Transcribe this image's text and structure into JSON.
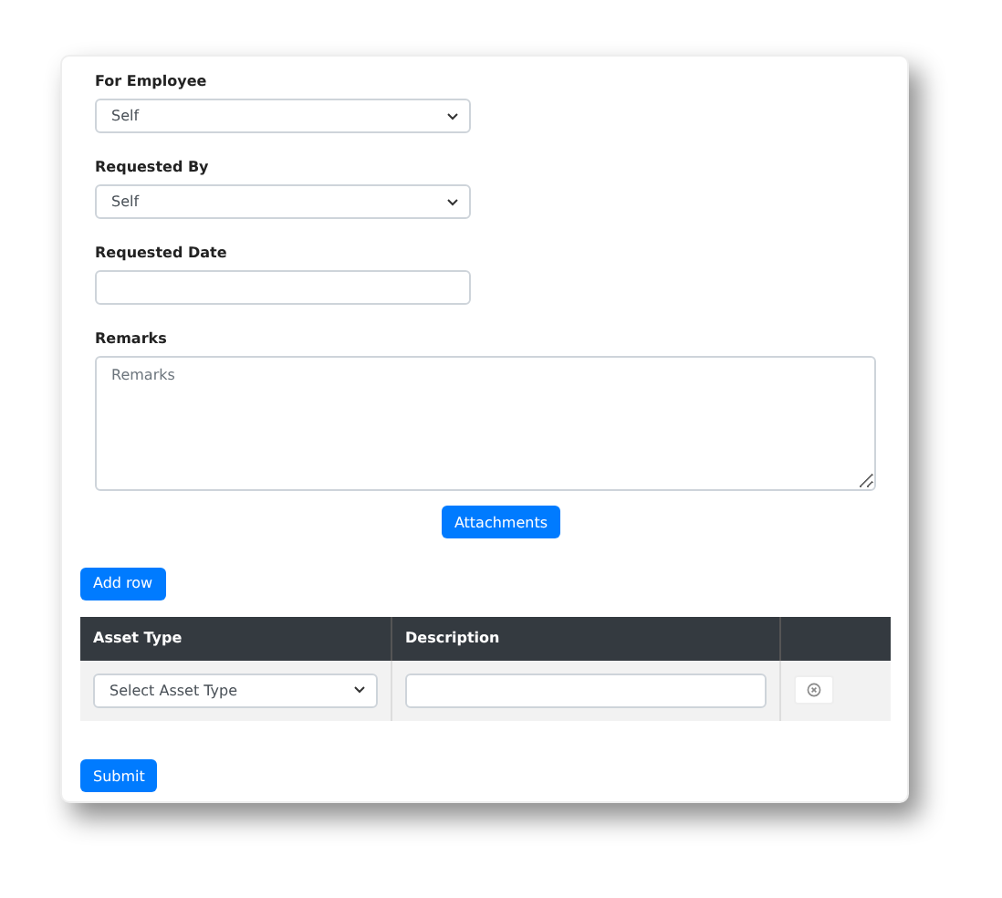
{
  "fields": [
    {
      "kind": "select",
      "label": "For Employee",
      "value": "Self"
    },
    {
      "kind": "select",
      "label": "Requested By",
      "value": "Self"
    },
    {
      "kind": "input",
      "label": "Requested Date"
    },
    {
      "kind": "textarea",
      "label": "Remarks",
      "placeholder": "Remarks"
    }
  ],
  "attachments_button": "Attachments",
  "add_row_button": "Add row",
  "table": {
    "columns": [
      "Asset Type",
      "Description"
    ],
    "rows": [
      {
        "asset_type": "Select Asset Type"
      }
    ]
  },
  "submit_button": "Submit"
}
